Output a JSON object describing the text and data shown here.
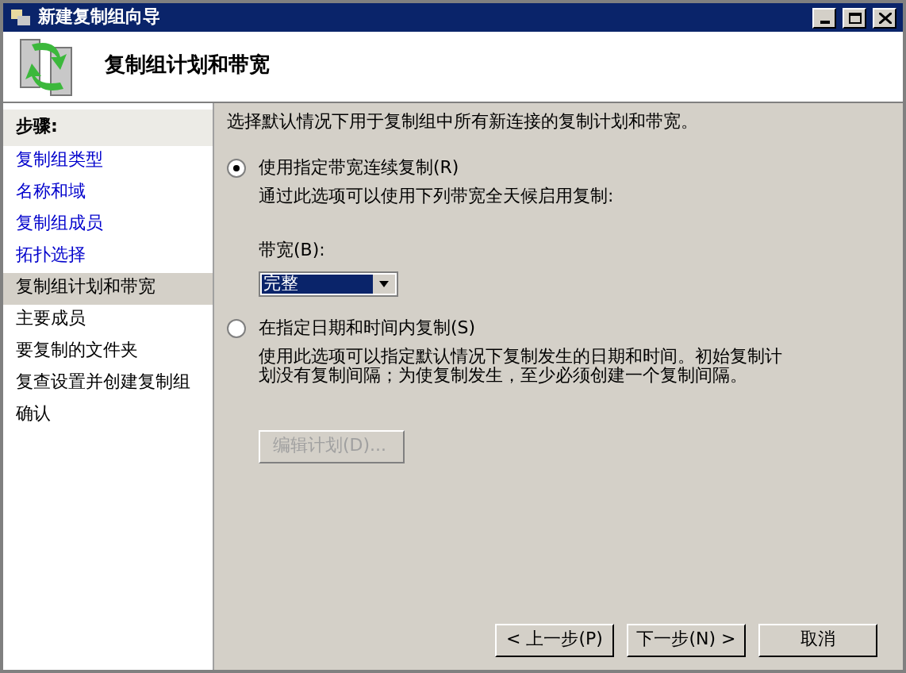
{
  "window": {
    "title": "新建复制组向导"
  },
  "header": {
    "title": "复制组计划和带宽"
  },
  "sidebar": {
    "heading": "步骤:",
    "items": [
      {
        "label": "复制组类型",
        "done": true,
        "selected": false
      },
      {
        "label": "名称和域",
        "done": true,
        "selected": false
      },
      {
        "label": "复制组成员",
        "done": true,
        "selected": false
      },
      {
        "label": "拓扑选择",
        "done": true,
        "selected": false
      },
      {
        "label": "复制组计划和带宽",
        "done": false,
        "selected": true
      },
      {
        "label": "主要成员",
        "done": false,
        "selected": false
      },
      {
        "label": "要复制的文件夹",
        "done": false,
        "selected": false
      },
      {
        "label": "复查设置并创建复制组",
        "done": false,
        "selected": false
      },
      {
        "label": "确认",
        "done": false,
        "selected": false
      }
    ]
  },
  "intro": "选择默认情况下用于复制组中所有新连接的复制计划和带宽。",
  "options": [
    {
      "label": "使用指定带宽连续复制(R)",
      "selected": true,
      "description": "通过此选项可以使用下列带宽全天候启用复制:",
      "bandwidth": {
        "label": "带宽(B):",
        "value": "完整"
      }
    },
    {
      "label": "在指定日期和时间内复制(S)",
      "selected": false,
      "description": "使用此选项可以指定默认情况下复制发生的日期和时间。初始复制计划没有复制间隔；为使复制发生，至少必须创建一个复制间隔。",
      "button": {
        "label": "编辑计划(D)...",
        "disabled": true
      }
    }
  ],
  "buttons": [
    {
      "label": "< 上一步(P)",
      "disabled": false
    },
    {
      "label": "下一步(N) >",
      "disabled": false
    },
    {
      "label": "取消",
      "disabled": false
    }
  ]
}
